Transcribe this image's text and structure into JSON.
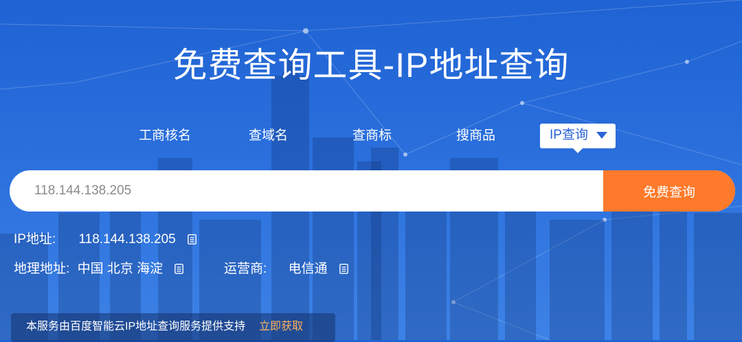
{
  "page": {
    "title": "免费查询工具-IP地址查询"
  },
  "tabs": [
    {
      "label": "工商核名"
    },
    {
      "label": "查域名"
    },
    {
      "label": "查商标"
    },
    {
      "label": "搜商品"
    },
    {
      "label": "IP查询",
      "active": true
    }
  ],
  "search": {
    "placeholder": "118.144.138.205",
    "button_label": "免费查询"
  },
  "result": {
    "ip_label": "IP地址:",
    "ip_value": "118.144.138.205",
    "geo_label": "地理地址:",
    "geo_value": "中国 北京 海淀",
    "isp_label": "运营商:",
    "isp_value": "电信通"
  },
  "footer": {
    "text": "本服务由百度智能云IP地址查询服务提供支持",
    "link": "立即获取"
  },
  "colors": {
    "background": "#2a6fdc",
    "accent": "#ff7a2b",
    "link": "#ffb35c"
  }
}
